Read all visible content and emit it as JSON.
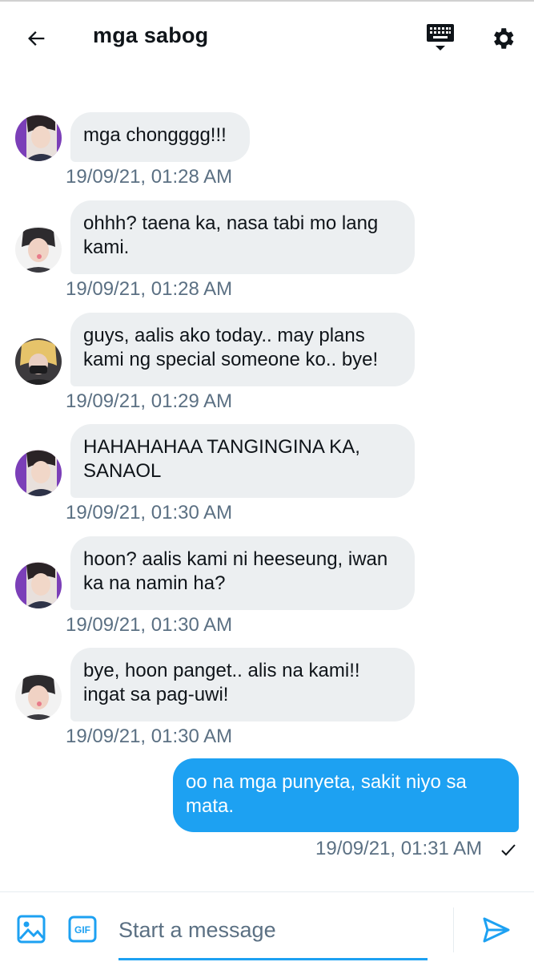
{
  "header": {
    "title": "mga sabog",
    "icons": {
      "back": "arrow-left-icon",
      "keyboard": "keyboard-icon",
      "settings": "gear-icon"
    }
  },
  "messages": [
    {
      "avatar": "avatar-purple-bg",
      "text": "mga chongggg!!!",
      "time": "19/09/21, 01:28 AM"
    },
    {
      "avatar": "avatar-white-bg",
      "text": "ohhh? taena ka, nasa tabi mo lang kami.",
      "time": "19/09/21, 01:28 AM"
    },
    {
      "avatar": "avatar-blond-hair",
      "text": "guys, aalis ako today.. may plans kami ng special someone ko.. bye!",
      "time": "19/09/21, 01:29 AM"
    },
    {
      "avatar": "avatar-purple-bg",
      "text": "HAHAHAHAA TANGINGINA KA, SANAOL",
      "time": "19/09/21, 01:30 AM"
    },
    {
      "avatar": "avatar-purple-bg",
      "text": "hoon? aalis kami ni heeseung, iwan ka na namin ha?",
      "time": "19/09/21, 01:30 AM"
    },
    {
      "avatar": "avatar-white-bg",
      "text": "bye, hoon panget.. alis na kami!! ingat sa pag-uwi!",
      "time": "19/09/21, 01:30 AM"
    }
  ],
  "outgoing": {
    "text": "oo na mga punyeta, sakit niyo sa mata.",
    "time": "19/09/21, 01:31 AM",
    "status": "sent-check-icon"
  },
  "composer": {
    "placeholder": "Start a message",
    "icons": {
      "image": "image-icon",
      "gif": "gif-icon",
      "send": "send-icon"
    }
  },
  "colors": {
    "accent": "#1da1f2",
    "bubble_in": "#eceff1",
    "muted": "#5b7083"
  }
}
